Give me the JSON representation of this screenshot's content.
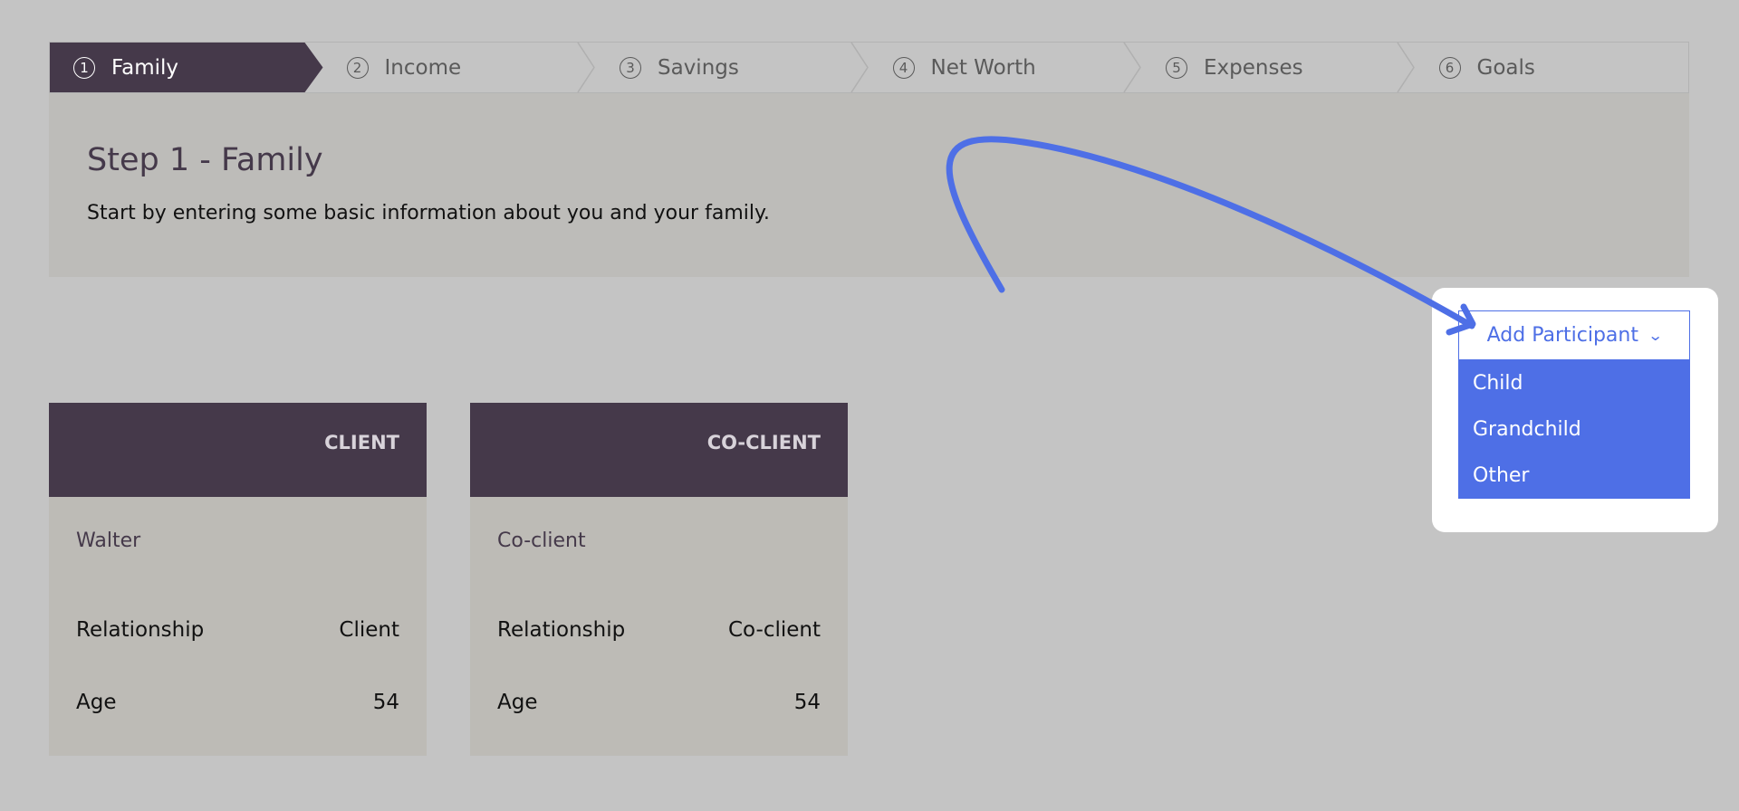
{
  "stepper": {
    "steps": [
      {
        "num": "1",
        "label": "Family"
      },
      {
        "num": "2",
        "label": "Income"
      },
      {
        "num": "3",
        "label": "Savings"
      },
      {
        "num": "4",
        "label": "Net Worth"
      },
      {
        "num": "5",
        "label": "Expenses"
      },
      {
        "num": "6",
        "label": "Goals"
      }
    ],
    "active": 1
  },
  "intro": {
    "title": "Step 1 - Family",
    "description": "Start by entering some basic information about you and your family."
  },
  "cards": [
    {
      "header": "CLIENT",
      "name": "Walter",
      "relationship_label": "Relationship",
      "relationship": "Client",
      "age_label": "Age",
      "age": "54"
    },
    {
      "header": "CO-CLIENT",
      "name": "Co-client",
      "relationship_label": "Relationship",
      "relationship": "Co-client",
      "age_label": "Age",
      "age": "54"
    }
  ],
  "dropdown": {
    "label": "Add Participant",
    "items": [
      "Child",
      "Grandchild",
      "Other"
    ]
  },
  "colors": {
    "accent": "#4e6fe6",
    "brand_dark": "#45394a",
    "background": "#c4c4c4"
  }
}
